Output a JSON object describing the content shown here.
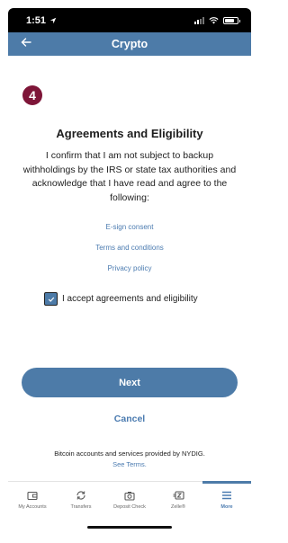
{
  "status_bar": {
    "time": "1:51"
  },
  "header": {
    "title": "Crypto",
    "back_icon": "arrow-left-icon"
  },
  "step": {
    "number": "4"
  },
  "title": "Agreements and Eligibility",
  "body": "I confirm that I am not subject to backup withholdings by the IRS or state tax authorities and acknowledge that I have read and agree to the following:",
  "links": {
    "esign": "E-sign consent",
    "terms": "Terms and conditions",
    "privacy": "Privacy policy"
  },
  "accept": {
    "label": "I accept agreements and eligibility",
    "checked": true
  },
  "buttons": {
    "next": "Next",
    "cancel": "Cancel"
  },
  "disclaimer": {
    "text": "Bitcoin accounts and services provided by NYDIG.",
    "see_terms": "See Terms."
  },
  "tabs": [
    {
      "label": "My Accounts",
      "icon": "wallet-icon"
    },
    {
      "label": "Transfers",
      "icon": "transfer-icon"
    },
    {
      "label": "Deposit Check",
      "icon": "camera-icon"
    },
    {
      "label": "Zelle®",
      "icon": "zelle-icon"
    },
    {
      "label": "More",
      "icon": "menu-icon",
      "active": true
    }
  ],
  "colors": {
    "accent": "#4d7ba8",
    "step_badge": "#7e1538",
    "link": "#4b7bb0"
  }
}
